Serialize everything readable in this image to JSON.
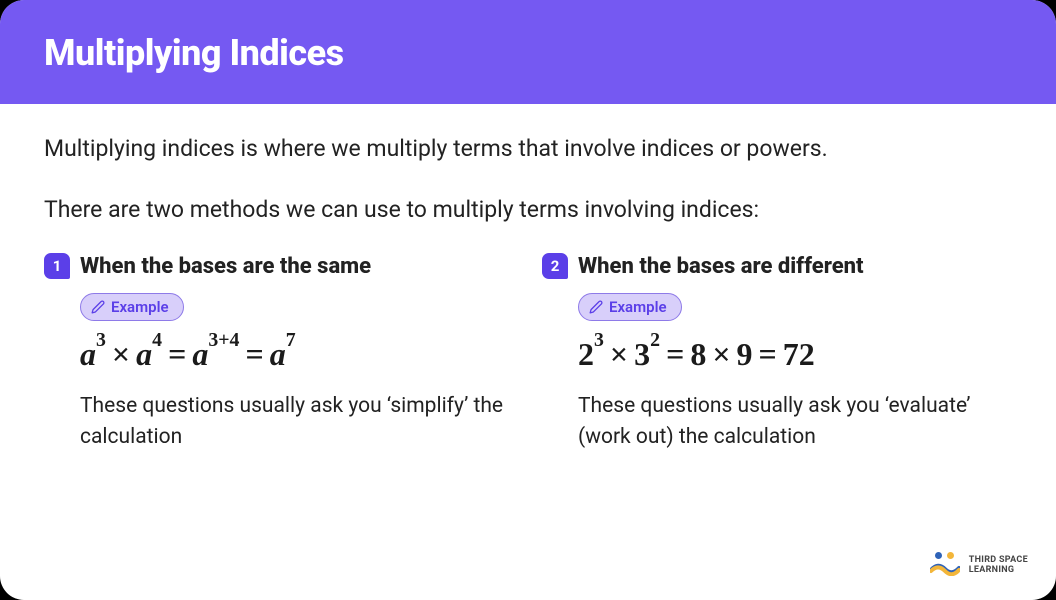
{
  "header": {
    "title": "Multiplying Indices"
  },
  "intro1": "Multiplying indices is where we multiply terms that involve indices or powers.",
  "intro2": "There are two methods we can use to multiply terms involving indices:",
  "example_label": "Example",
  "columns": [
    {
      "num": "1",
      "title": "When the bases are the same",
      "equation_parts": {
        "b1": "a",
        "e1": "3",
        "b2": "a",
        "e2": "4",
        "b3": "a",
        "e3": "3+4",
        "b4": "a",
        "e4": "7"
      },
      "explain": "These questions usually ask you ‘simplify’ the calculation"
    },
    {
      "num": "2",
      "title": "When the bases are different",
      "equation_parts": {
        "b1": "2",
        "e1": "3",
        "b2": "3",
        "e2": "2",
        "r1": "8",
        "r2": "9",
        "r3": "72"
      },
      "explain": "These questions usually ask you ‘evaluate’ (work out) the calculation"
    }
  ],
  "brand": {
    "line1": "THIRD SPACE",
    "line2": "LEARNING"
  }
}
